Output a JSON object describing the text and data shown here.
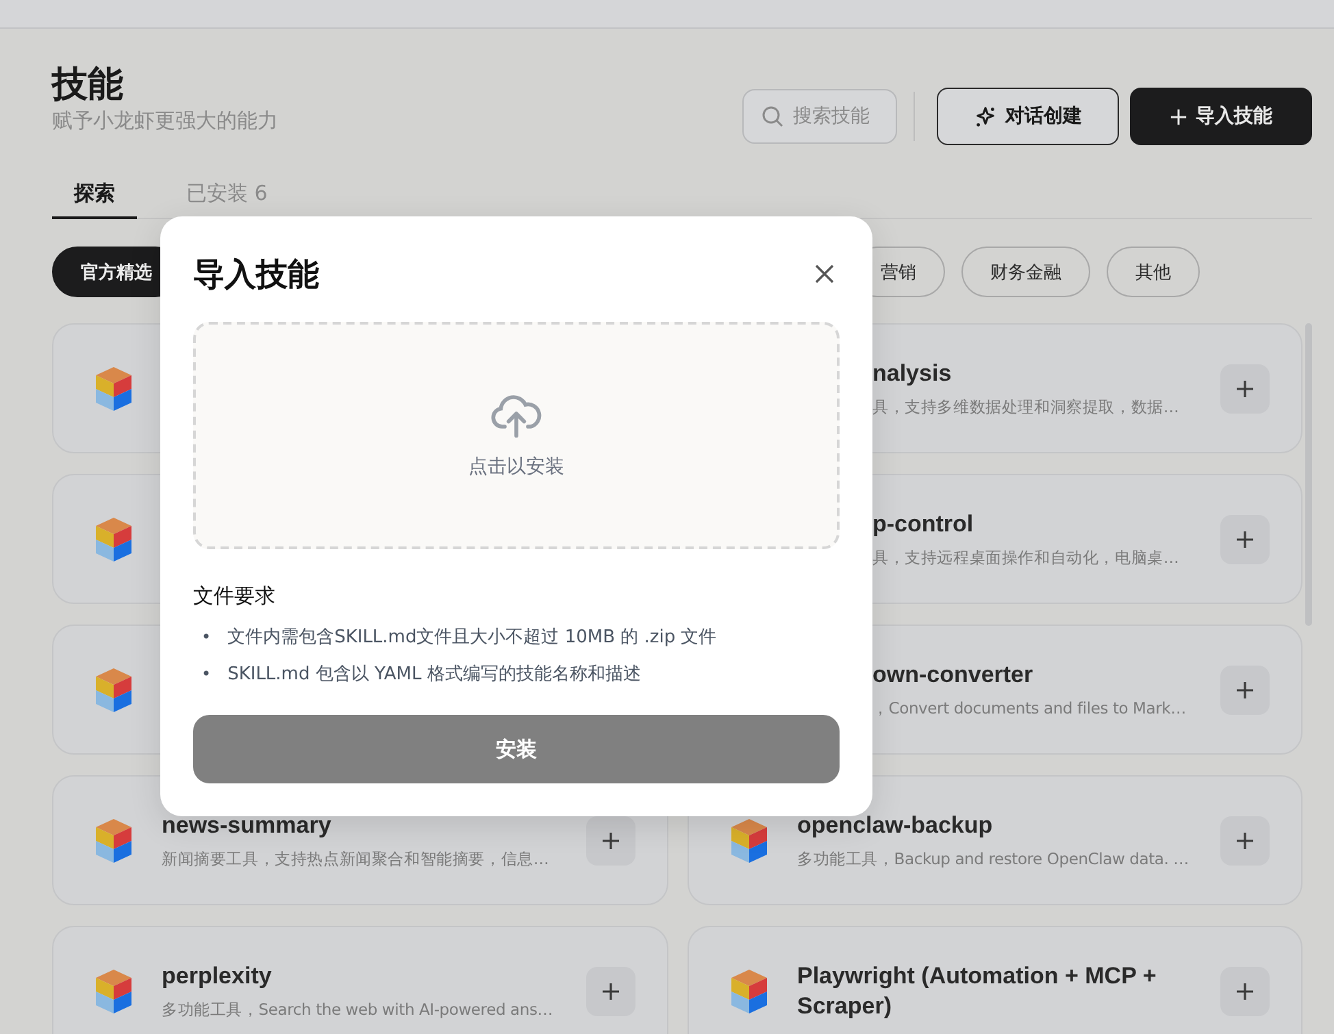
{
  "header": {
    "title": "技能",
    "subtitle": "赋予小龙虾更强大的能力",
    "search": {
      "placeholder": "搜索技能"
    },
    "buttons": [
      {
        "kind": "outline",
        "label": "对话创建"
      },
      {
        "kind": "primary",
        "label": "导入技能"
      }
    ]
  },
  "tabs": [
    {
      "label": "探索",
      "selected": true
    },
    {
      "label": "已安装 6",
      "selected": false
    }
  ],
  "chips": [
    {
      "label": "官方精选",
      "selected": true
    },
    {
      "label": "营销",
      "selected": false
    },
    {
      "label": "财务金融",
      "selected": false
    },
    {
      "label": "其他",
      "selected": false
    }
  ],
  "cards": [
    {
      "kind": "covered"
    },
    {
      "kind": "partial",
      "name": "nalysis",
      "description": "具，支持多维数据处理和洞察提取，数据…"
    },
    {
      "kind": "covered"
    },
    {
      "kind": "partial",
      "name": "p-control",
      "description": "具，支持远程桌面操作和自动化，电脑桌…"
    },
    {
      "kind": "covered"
    },
    {
      "kind": "partial",
      "name": "own-converter",
      "description": "，Convert documents and files to Mark…"
    },
    {
      "kind": "full",
      "name": "news-summary",
      "description": "新闻摘要工具，支持热点新闻聚合和智能摘要，信息…"
    },
    {
      "kind": "full",
      "name": "openclaw-backup",
      "description": "多功能工具，Backup and restore OpenClaw data. …"
    },
    {
      "kind": "full",
      "name": "perplexity",
      "description": "多功能工具，Search the web with AI-powered ans…"
    },
    {
      "kind": "full",
      "name": "Playwright (Automation + MCP + Scraper)"
    }
  ],
  "dialog": {
    "title": "导入技能",
    "dropzone": {
      "label": "点击以安装"
    },
    "requirements_title": "文件要求",
    "requirements": [
      {
        "bullet": "•",
        "text": "文件内需包含SKILL.md文件且大小不超过 10MB 的 .zip 文件"
      },
      {
        "bullet": "•",
        "text": "SKILL.md 包含以 YAML 格式编写的技能名称和描述"
      }
    ],
    "install_button": {
      "label": "安装",
      "disabled": true
    }
  }
}
